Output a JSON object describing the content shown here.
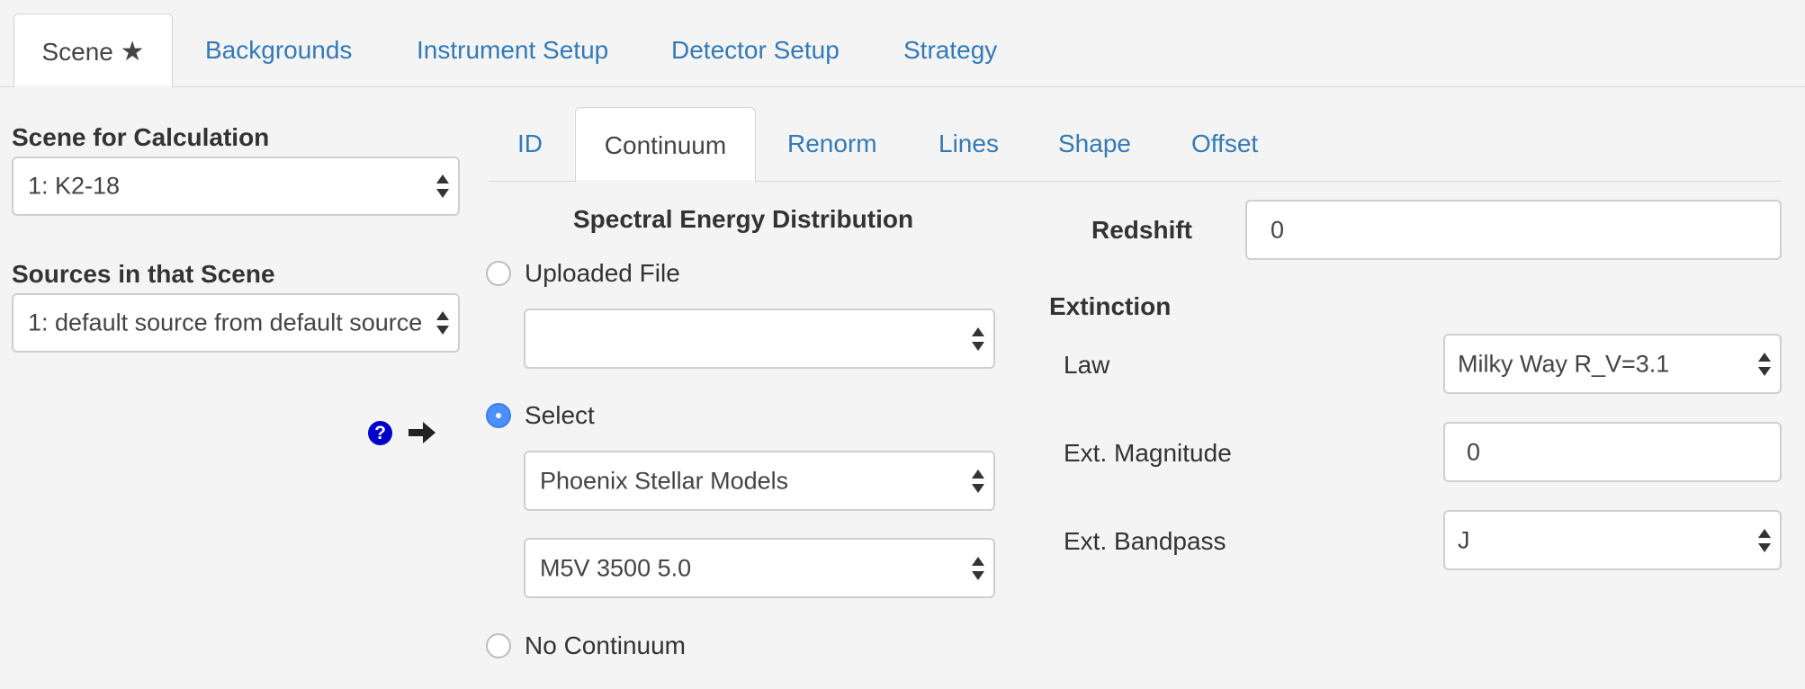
{
  "main_tabs": [
    {
      "label": "Scene",
      "active": true
    },
    {
      "label": "Backgrounds"
    },
    {
      "label": "Instrument Setup"
    },
    {
      "label": "Detector Setup"
    },
    {
      "label": "Strategy"
    }
  ],
  "scene_star": "★",
  "left": {
    "scene_heading": "Scene for Calculation",
    "scene_select": "1: K2-18",
    "sources_heading": "Sources in that Scene",
    "sources_select": "1: default source from default source"
  },
  "sub_tabs": [
    {
      "label": "ID"
    },
    {
      "label": "Continuum",
      "active": true
    },
    {
      "label": "Renorm"
    },
    {
      "label": "Lines"
    },
    {
      "label": "Shape"
    },
    {
      "label": "Offset"
    }
  ],
  "sed": {
    "heading": "Spectral Energy Distribution",
    "uploaded_label": "Uploaded File",
    "uploaded_value": "",
    "select_label": "Select",
    "select_selected": true,
    "model_family": "Phoenix Stellar Models",
    "model": "M5V 3500 5.0",
    "no_continuum_label": "No Continuum"
  },
  "redshift": {
    "label": "Redshift",
    "value": "0"
  },
  "extinction": {
    "heading": "Extinction",
    "law_label": "Law",
    "law_value": "Milky Way R_V=3.1",
    "mag_label": "Ext. Magnitude",
    "mag_value": "0",
    "bandpass_label": "Ext. Bandpass",
    "bandpass_value": "J"
  },
  "icons": {
    "help": "?",
    "arrow": "➜"
  },
  "colors": {
    "link": "#337ab7",
    "help": "#0000cc",
    "radio_on": "#4a90ff"
  }
}
